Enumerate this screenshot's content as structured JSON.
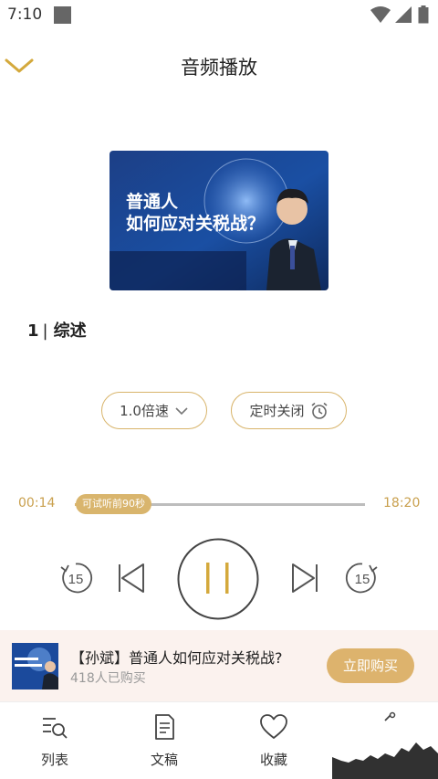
{
  "status_bar": {
    "time": "7:10"
  },
  "header": {
    "title": "音频播放",
    "collapse_icon": "chevron-down-icon"
  },
  "cover": {
    "text_line1": "普通人",
    "text_line2": "如何应对关税战？"
  },
  "episode": {
    "number": "1",
    "separator": "|",
    "title": "综述"
  },
  "controls": {
    "speed_label": "1.0倍速",
    "timer_label": "定时关闭"
  },
  "progress": {
    "current": "00:14",
    "total": "18:20",
    "trial_badge": "可试听前90秒",
    "fraction": 0.013
  },
  "playback": {
    "rewind_seconds": "15",
    "forward_seconds": "15",
    "state": "playing"
  },
  "purchase": {
    "title": "【孙斌】普通人如何应对关税战?",
    "count": "418人已购买",
    "button": "立即购买"
  },
  "tabs": [
    {
      "label": "列表",
      "icon": "list-search-icon"
    },
    {
      "label": "文稿",
      "icon": "document-icon"
    },
    {
      "label": "收藏",
      "icon": "heart-icon"
    }
  ],
  "colors": {
    "accent": "#d9b56d",
    "accent_text": "#c9a04e",
    "buy_bar_bg": "#fbf2ee"
  }
}
